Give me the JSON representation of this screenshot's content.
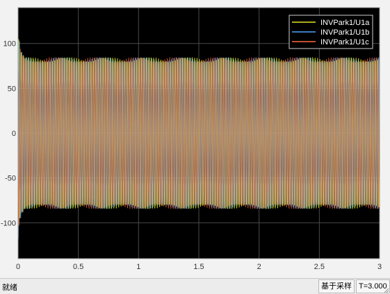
{
  "status": {
    "left_text": "就绪",
    "mode_text": "基于采样",
    "time_text": "T=3.000"
  },
  "chart_data": {
    "type": "line",
    "title": "",
    "xlabel": "",
    "ylabel": "",
    "xlim": [
      0,
      3
    ],
    "ylim": [
      -140,
      140
    ],
    "xticks": [
      "0",
      "0.5",
      "1",
      "1.5",
      "2",
      "2.5",
      "3"
    ],
    "xtick_values": [
      0,
      0.5,
      1,
      1.5,
      2,
      2.5,
      3
    ],
    "yticks": [
      "100",
      "50",
      "0",
      "-50",
      "-100"
    ],
    "ytick_values": [
      100,
      50,
      0,
      -50,
      -100
    ],
    "grid": true,
    "legend_position": "top-right",
    "series": [
      {
        "name": "INVPark1/U1a",
        "color": "#e6e629",
        "amplitude": 83,
        "frequency": 50,
        "phase_deg": 0
      },
      {
        "name": "INVPark1/U1b",
        "color": "#4da6ff",
        "amplitude": 83,
        "frequency": 50,
        "phase_deg": -120
      },
      {
        "name": "INVPark1/U1c",
        "color": "#ff6e3d",
        "amplitude": 83,
        "frequency": 50,
        "phase_deg": 120
      }
    ],
    "startup_peaks": [
      118,
      -118
    ],
    "background": "#000000"
  }
}
